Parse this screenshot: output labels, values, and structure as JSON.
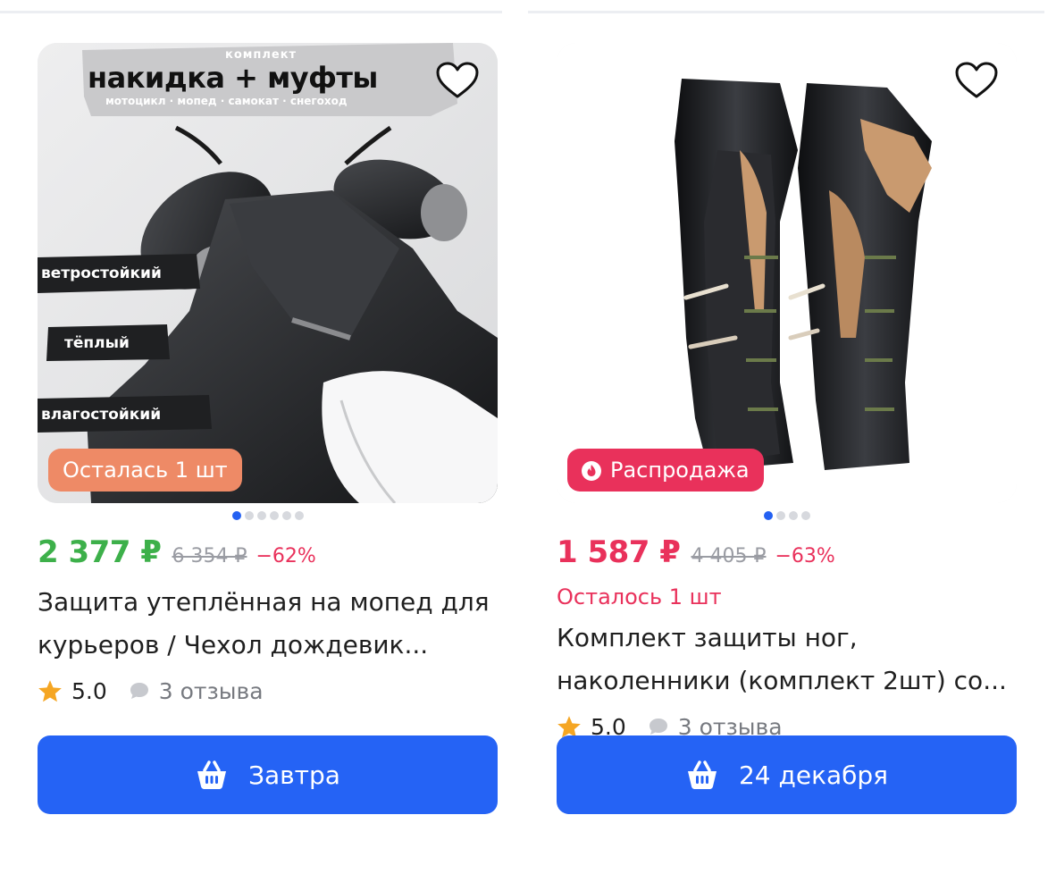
{
  "products": [
    {
      "image": {
        "caption_small": "комплект",
        "caption_big": "накидка + муфты",
        "caption_sub": "мотоцикл · мопед · самокат · снегоход",
        "tag_1": "ветростойкий",
        "tag_2": "тёплый",
        "tag_3": "влагостойкий"
      },
      "badge": "Осталась 1 шт",
      "price": "2 377 ₽",
      "old_price": "6 354 ₽",
      "discount": "−62%",
      "title": "Защита утеплённая на мопед для курьеров / Чехол дождевик...",
      "rating": "5.0",
      "reviews": "3 отзыва",
      "delivery": "Завтра",
      "dots_total": 6,
      "dots_active": 0
    },
    {
      "badge": "Распродажа",
      "price": "1 587 ₽",
      "old_price": "4 405 ₽",
      "discount": "−63%",
      "stock": "Осталось 1 шт",
      "title": "Комплект защиты ног, наколенники (комплект 2шт) со...",
      "rating": "5.0",
      "reviews": "3 отзыва",
      "delivery": "24 декабря",
      "dots_total": 4,
      "dots_active": 0
    }
  ],
  "colors": {
    "accent_blue": "#2563f5",
    "price_green": "#3db04a",
    "price_red": "#e9315b",
    "badge_orange": "#ee8a66",
    "star": "#f5a623"
  },
  "icons": {
    "favorite": "heart-icon",
    "rating": "star-icon",
    "reviews": "speech-bubble-icon",
    "cart": "basket-icon",
    "sale": "fire-icon"
  }
}
